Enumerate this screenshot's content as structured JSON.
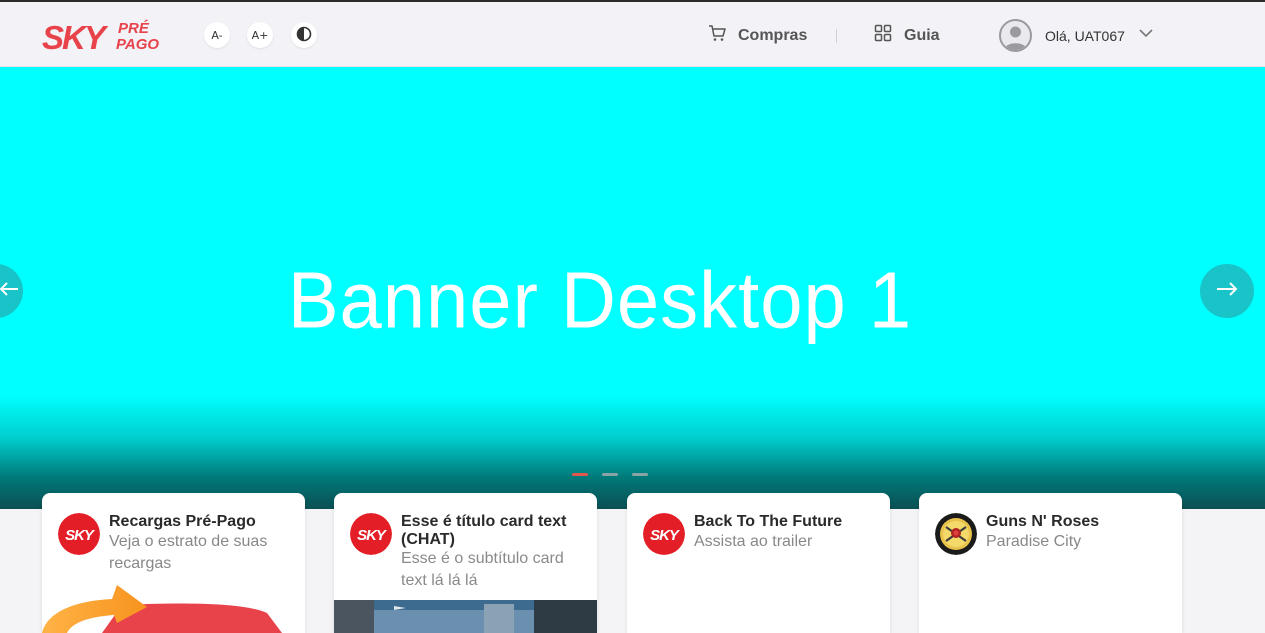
{
  "header": {
    "logo_main": "SKY",
    "logo_sub_top": "PRÉ",
    "logo_sub_bottom": "PAGO",
    "font_decrease_label": "A-",
    "font_increase_label": "A+",
    "contrast_icon": "contrast-icon",
    "nav": [
      {
        "label": "Compras",
        "icon": "cart-icon"
      },
      {
        "label": "Guia",
        "icon": "grid-icon"
      }
    ],
    "user_greeting": "Olá, UAT067"
  },
  "banner": {
    "text": "Banner Desktop 1",
    "slide_count": 3,
    "active_slide": 1,
    "color": "#00ffff"
  },
  "cards": [
    {
      "title": "Recargas Pré-Pago",
      "subtitle": "Veja o estrato de suas recargas",
      "icon": "sky-logo-icon"
    },
    {
      "title": "Esse é título card text (CHAT)",
      "subtitle": "Esse é o subtítulo card text lá lá lá",
      "icon": "sky-logo-icon"
    },
    {
      "title": "Back To The Future",
      "subtitle": "Assista ao trailer",
      "icon": "sky-logo-icon"
    },
    {
      "title": "Guns N' Roses",
      "subtitle": "Paradise City",
      "icon": "guns-n-roses-logo-icon"
    }
  ],
  "colors": {
    "brand_red": "#e41e26",
    "banner_cyan": "#00ffff",
    "arrow_teal": "#18c4c8",
    "dot_active": "#e2574c"
  }
}
